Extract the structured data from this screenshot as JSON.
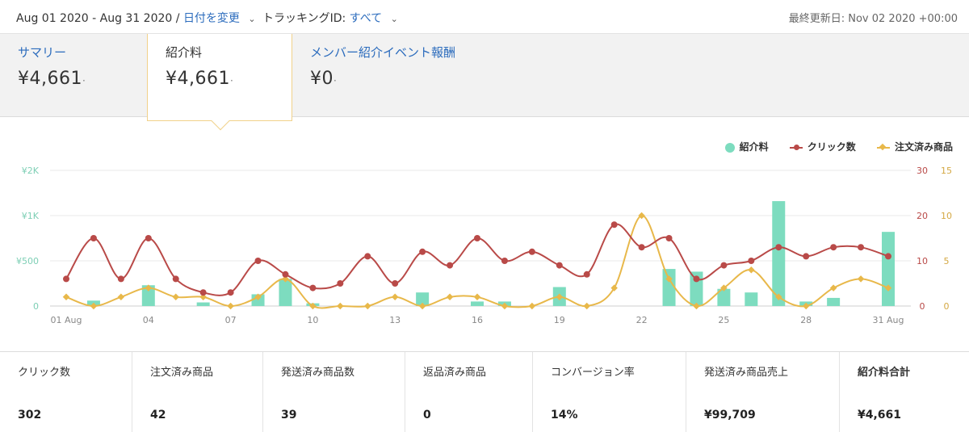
{
  "header": {
    "date_range": "Aug 01 2020 - Aug 31 2020 /",
    "change_date_link": "日付を変更",
    "tracking_label": "トラッキングID:",
    "tracking_value": "すべて",
    "last_updated": "最終更新日: Nov 02 2020 +00:00"
  },
  "tabs": [
    {
      "label": "サマリー",
      "value": "¥4,661"
    },
    {
      "label": "紹介料",
      "value": "¥4,661"
    },
    {
      "label": "メンバー紹介イベント報酬",
      "value": "¥0"
    }
  ],
  "colors": {
    "bar": "#7ddcbf",
    "clicks": "#b94a48",
    "orders": "#e8b84a",
    "link": "#2c6cbd"
  },
  "chart_data": {
    "type": "bar",
    "x": [
      "01 Aug",
      "02",
      "03",
      "04",
      "05",
      "06",
      "07",
      "08",
      "09",
      "10",
      "11",
      "12",
      "13",
      "14",
      "15",
      "16",
      "17",
      "18",
      "19",
      "20",
      "21",
      "22",
      "23",
      "24",
      "25",
      "26",
      "27",
      "28",
      "29",
      "30",
      "31 Aug"
    ],
    "x_tick_labels": [
      "01 Aug",
      "04",
      "07",
      "10",
      "13",
      "16",
      "19",
      "22",
      "25",
      "28",
      "31 Aug"
    ],
    "left_axis": {
      "ticks": [
        "0",
        "¥500",
        "¥1K",
        "¥2K"
      ],
      "ylim": [
        0,
        1500
      ]
    },
    "right_axis_clicks": {
      "ticks": [
        "0",
        "10",
        "20",
        "30"
      ],
      "ylim": [
        0,
        30
      ]
    },
    "right_axis_orders": {
      "ticks": [
        "0",
        "5",
        "10",
        "15"
      ],
      "ylim": [
        0,
        15
      ]
    },
    "legend_position": "top-right",
    "series": [
      {
        "name": "紹介料",
        "type": "bar",
        "axis": "left",
        "values": [
          0,
          60,
          0,
          230,
          0,
          40,
          0,
          130,
          300,
          30,
          0,
          0,
          0,
          150,
          0,
          50,
          50,
          0,
          210,
          0,
          0,
          0,
          410,
          380,
          190,
          150,
          1160,
          50,
          90,
          0,
          820
        ]
      },
      {
        "name": "クリック数",
        "type": "line",
        "axis": "right_clicks",
        "values": [
          6,
          15,
          6,
          15,
          6,
          3,
          3,
          10,
          7,
          4,
          5,
          11,
          5,
          12,
          9,
          15,
          10,
          12,
          9,
          7,
          18,
          13,
          15,
          6,
          9,
          10,
          13,
          11,
          13,
          13,
          11
        ]
      },
      {
        "name": "注文済み商品",
        "type": "line",
        "axis": "right_orders",
        "values": [
          1,
          0,
          1,
          2,
          1,
          1,
          0,
          1,
          3,
          0,
          0,
          0,
          1,
          0,
          1,
          1,
          0,
          0,
          1,
          0,
          2,
          10,
          3,
          0,
          2,
          4,
          1,
          0,
          2,
          3,
          2
        ]
      }
    ]
  },
  "stats": [
    {
      "label": "クリック数",
      "value": "302"
    },
    {
      "label": "注文済み商品",
      "value": "42"
    },
    {
      "label": "発送済み商品数",
      "value": "39"
    },
    {
      "label": "返品済み商品",
      "value": "0"
    },
    {
      "label": "コンバージョン率",
      "value": "14%"
    },
    {
      "label": "発送済み商品売上",
      "value": "¥99,709"
    },
    {
      "label": "紹介料合計",
      "value": "¥4,661"
    }
  ]
}
